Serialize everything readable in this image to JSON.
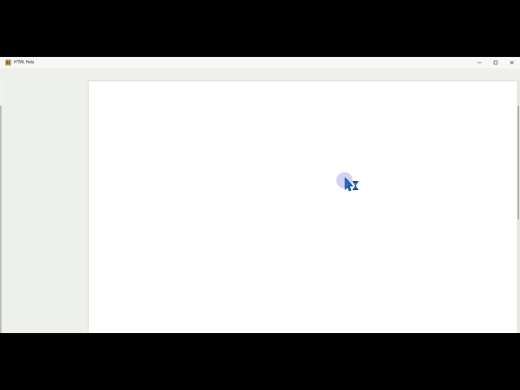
{
  "window": {
    "title": "HTML Help",
    "icon": "help-book-icon"
  },
  "controls": {
    "minimize": "minimize-icon",
    "maximize": "maximize-icon",
    "close": "close-icon"
  },
  "cursor": {
    "state": "busy",
    "icon": "arrow-hourglass-cursor-icon"
  },
  "colors": {
    "titlebar": "#f7f8f6",
    "chrome": "#eef0ec",
    "content": "#ffffff",
    "cursor_halo": "#7882e6"
  }
}
